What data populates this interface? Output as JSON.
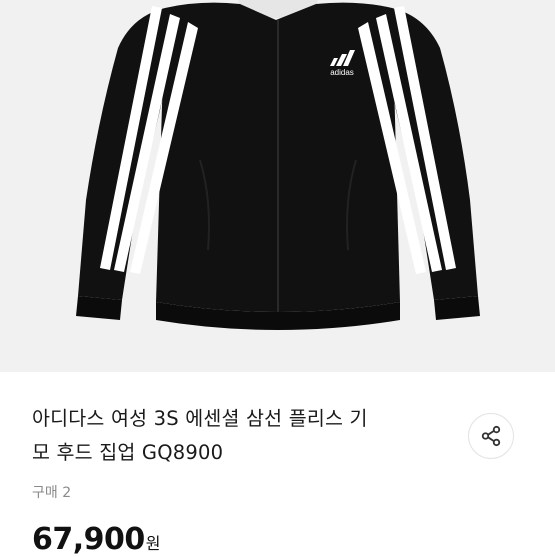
{
  "product": {
    "brand_logo_text": "adidas",
    "title_line1": "아디다스 여성 3S 에센셜 삼선 플리스 기",
    "title_line2": "모 후드 집업 GQ8900",
    "purchase_count": "구매 2",
    "price": "67,900",
    "currency": "원"
  },
  "share": {
    "icon": "share-icon"
  },
  "colors": {
    "jacket": "#111111",
    "stripe": "#ffffff",
    "background": "#f1f1f1",
    "text": "#1a1a1a",
    "muted": "#8a8a8a"
  }
}
